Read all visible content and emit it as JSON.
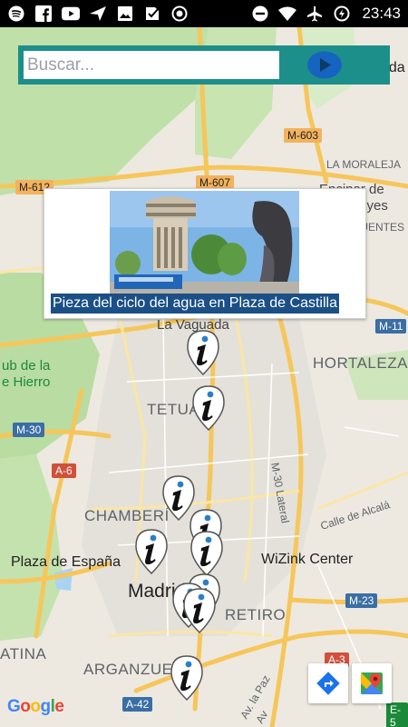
{
  "status_bar": {
    "time": "23:43",
    "left_icons": [
      "spotify-icon",
      "facebook-icon",
      "youtube-icon",
      "send-icon",
      "photo-icon",
      "check-icon",
      "record-icon"
    ],
    "right_icons": [
      "dnd-icon",
      "wifi-icon",
      "airplane-icon",
      "data-saver-icon"
    ]
  },
  "search": {
    "placeholder": "Buscar...",
    "value": "",
    "go_icon": "play-icon"
  },
  "popup": {
    "caption": "Pieza del ciclo del agua en Plaza de Castilla",
    "image_icon": "water-tower-photo"
  },
  "map": {
    "labels": {
      "moraleja": "LA MORALEJA",
      "encinar": "Encinar de",
      "reyes": "los Reyes",
      "fuentes": "FUENTES",
      "vaguada": "La Vaguada",
      "hortaleza": "HORTALEZA",
      "club1": "ub de la",
      "club2": "e Hierro",
      "tetuan": "TETUÁ",
      "m30lateral": "M-30 Lateral",
      "calle_alcala": "Calle de Alcalá",
      "chamberi": "CHAMBERÍ",
      "plaza_espana": "Plaza de España",
      "wizink": "WiZink Center",
      "madrid": "Madrid",
      "retiro": "RETIRO",
      "latina": "ATINA",
      "arganzuela": "ARGANZUE",
      "av_paz": "Av. la Paz",
      "av_corner": "Av",
      "top_corner": "nda"
    },
    "shields": {
      "m603": "M-603",
      "m607": "M-607",
      "m612": "M-612",
      "m11": "M-11",
      "m30": "M-30",
      "a6": "A-6",
      "m23": "M-23",
      "a3": "A-3",
      "a42": "A-42",
      "e5": "E-5"
    },
    "marker_icon": "info-marker-icon"
  },
  "controls": {
    "directions_icon": "directions-icon",
    "google_maps_icon": "google-maps-icon",
    "logo": "Google"
  },
  "colors": {
    "search_bar": "#1d8f8a",
    "caption_bg": "#1b4f86",
    "park_green": "#b8dca3",
    "road_yellow": "#fbd46b"
  }
}
